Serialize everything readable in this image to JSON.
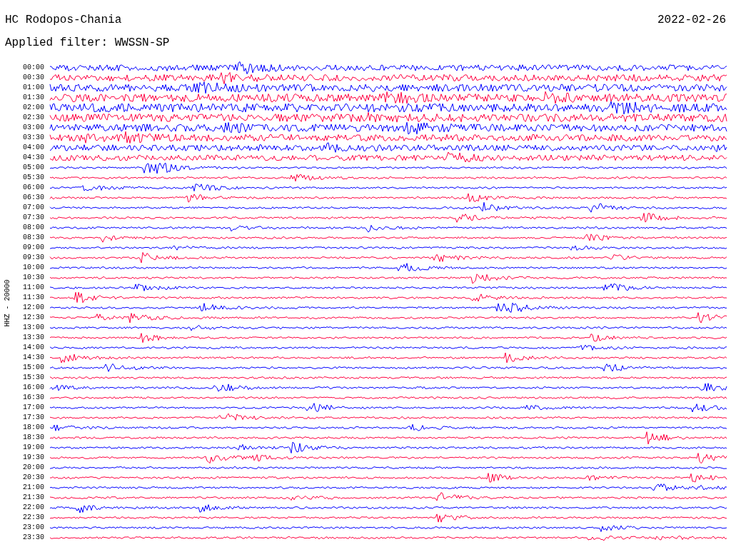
{
  "header": {
    "station": "HC Rodopos-Chania",
    "date": "2022-02-26",
    "filter": "Applied filter: WWSSN-SP"
  },
  "axis_label": "HHZ - 20000",
  "traces": [
    {
      "time": "00:00",
      "color": "#0000ff"
    },
    {
      "time": "00:30",
      "color": "#ff0040"
    },
    {
      "time": "01:00",
      "color": "#0000ff"
    },
    {
      "time": "01:30",
      "color": "#ff0040"
    },
    {
      "time": "02:00",
      "color": "#0000ff"
    },
    {
      "time": "02:30",
      "color": "#ff0040"
    },
    {
      "time": "03:00",
      "color": "#0000ff"
    },
    {
      "time": "03:30",
      "color": "#ff0040"
    },
    {
      "time": "04:00",
      "color": "#0000ff"
    },
    {
      "time": "04:30",
      "color": "#ff0040"
    },
    {
      "time": "05:00",
      "color": "#0000ff"
    },
    {
      "time": "05:30",
      "color": "#ff0040"
    },
    {
      "time": "06:00",
      "color": "#0000ff"
    },
    {
      "time": "06:30",
      "color": "#ff0040"
    },
    {
      "time": "07:00",
      "color": "#0000ff"
    },
    {
      "time": "07:30",
      "color": "#ff0040"
    },
    {
      "time": "08:00",
      "color": "#0000ff"
    },
    {
      "time": "08:30",
      "color": "#ff0040"
    },
    {
      "time": "09:00",
      "color": "#0000ff"
    },
    {
      "time": "09:30",
      "color": "#ff0040"
    },
    {
      "time": "10:00",
      "color": "#0000ff"
    },
    {
      "time": "10:30",
      "color": "#ff0040"
    },
    {
      "time": "11:00",
      "color": "#0000ff"
    },
    {
      "time": "11:30",
      "color": "#ff0040"
    },
    {
      "time": "12:00",
      "color": "#0000ff"
    },
    {
      "time": "12:30",
      "color": "#ff0040"
    },
    {
      "time": "13:00",
      "color": "#0000ff"
    },
    {
      "time": "13:30",
      "color": "#ff0040"
    },
    {
      "time": "14:00",
      "color": "#0000ff"
    },
    {
      "time": "14:30",
      "color": "#ff0040"
    },
    {
      "time": "15:00",
      "color": "#0000ff"
    },
    {
      "time": "15:30",
      "color": "#ff0040"
    },
    {
      "time": "16:00",
      "color": "#0000ff"
    },
    {
      "time": "16:30",
      "color": "#ff0040"
    },
    {
      "time": "17:00",
      "color": "#0000ff"
    },
    {
      "time": "17:30",
      "color": "#ff0040"
    },
    {
      "time": "18:00",
      "color": "#0000ff"
    },
    {
      "time": "18:30",
      "color": "#ff0040"
    },
    {
      "time": "19:00",
      "color": "#0000ff"
    },
    {
      "time": "19:30",
      "color": "#ff0040"
    },
    {
      "time": "20:00",
      "color": "#0000ff"
    },
    {
      "time": "20:30",
      "color": "#ff0040"
    },
    {
      "time": "21:00",
      "color": "#0000ff"
    },
    {
      "time": "21:30",
      "color": "#ff0040"
    },
    {
      "time": "22:00",
      "color": "#0000ff"
    },
    {
      "time": "22:30",
      "color": "#ff0040"
    },
    {
      "time": "23:00",
      "color": "#0000ff"
    },
    {
      "time": "23:30",
      "color": "#ff0040"
    }
  ]
}
